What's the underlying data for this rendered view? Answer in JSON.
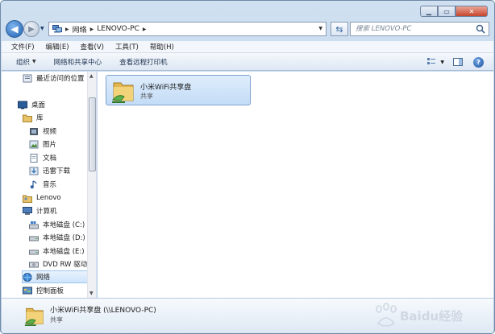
{
  "address": {
    "crumbs": [
      "网络",
      "LENOVO-PC"
    ]
  },
  "search": {
    "placeholder": "搜索 LENOVO-PC"
  },
  "menu": [
    "文件(F)",
    "编辑(E)",
    "查看(V)",
    "工具(T)",
    "帮助(H)"
  ],
  "commands": {
    "organize": "组织",
    "network_center": "网络和共享中心",
    "view_printers": "查看远程打印机"
  },
  "nav": [
    "最近访问的位置",
    "桌面",
    "库",
    "视频",
    "图片",
    "文档",
    "迅雷下载",
    "音乐",
    "Lenovo",
    "计算机",
    "本地磁盘 (C:)",
    "本地磁盘 (D:)",
    "本地磁盘 (E:)",
    "DVD RW 驱动",
    "网络",
    "控制面板"
  ],
  "content": {
    "share_name": "小米WiFi共享盘",
    "share_type": "共享"
  },
  "details": {
    "title": "小米WiFi共享盘 (\\\\LENOVO-PC)",
    "subtitle": "共享"
  },
  "watermark": {
    "text": "Baidu经验"
  }
}
